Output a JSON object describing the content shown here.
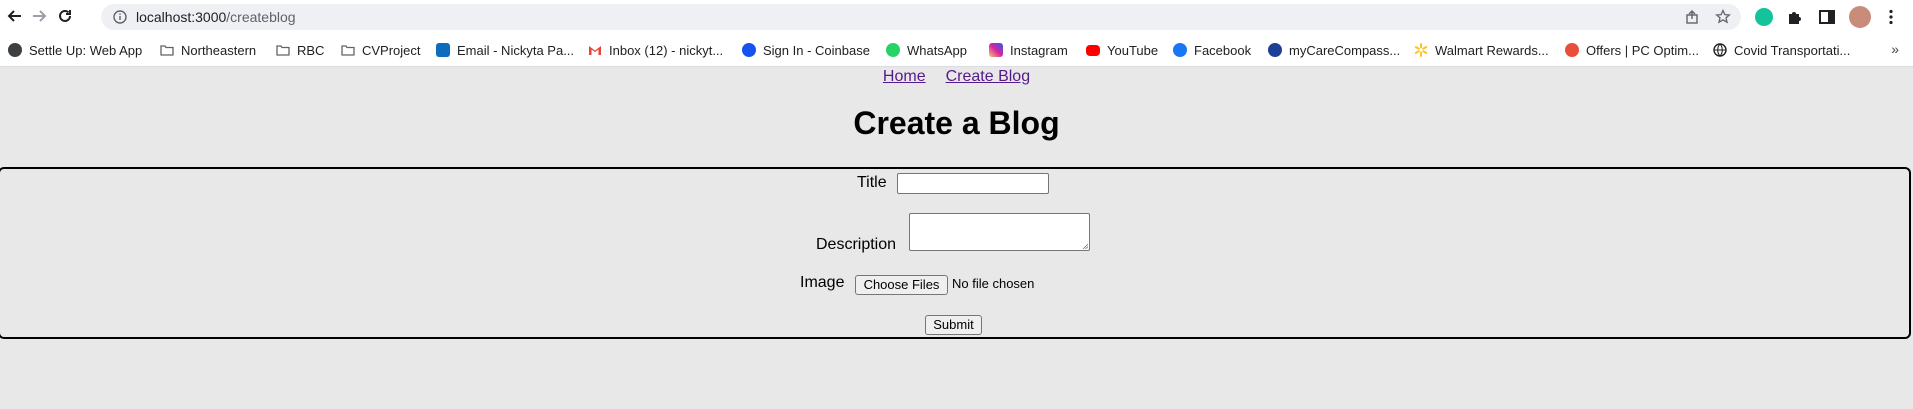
{
  "browser": {
    "url_host": "localhost:3000",
    "url_path": "/createblog",
    "bookmarks": [
      {
        "label": "Settle Up: Web App",
        "icon": "people-icon",
        "color": "#3c4043"
      },
      {
        "label": "Northeastern",
        "icon": "folder-icon",
        "color": "#5f6368"
      },
      {
        "label": "RBC",
        "icon": "folder-icon",
        "color": "#5f6368"
      },
      {
        "label": "CVProject",
        "icon": "folder-icon",
        "color": "#5f6368"
      },
      {
        "label": "Email - Nickyta Pa...",
        "icon": "outlook-icon",
        "color": "#0f6cbd"
      },
      {
        "label": "Inbox (12) - nickyt...",
        "icon": "gmail-icon",
        "color": "#ea4335"
      },
      {
        "label": "Sign In - Coinbase",
        "icon": "coinbase-icon",
        "color": "#1652f0"
      },
      {
        "label": "WhatsApp",
        "icon": "whatsapp-icon",
        "color": "#25d366"
      },
      {
        "label": "Instagram",
        "icon": "instagram-icon",
        "color": "#d6249f"
      },
      {
        "label": "YouTube",
        "icon": "youtube-icon",
        "color": "#ff0000"
      },
      {
        "label": "Facebook",
        "icon": "facebook-icon",
        "color": "#1877f2"
      },
      {
        "label": "myCareCompass...",
        "icon": "mycarecompass-icon",
        "color": "#1e3f96"
      },
      {
        "label": "Walmart Rewards...",
        "icon": "walmart-icon",
        "color": "#ffc220"
      },
      {
        "label": "Offers | PC Optim...",
        "icon": "pc-optimum-icon",
        "color": "#e94e3c"
      },
      {
        "label": "Covid Transportati...",
        "icon": "globe-icon",
        "color": "#202124"
      }
    ]
  },
  "nav": {
    "home": "Home",
    "create": "Create Blog"
  },
  "page": {
    "title": "Create a Blog"
  },
  "form": {
    "title_label": "Title",
    "title_value": "",
    "description_label": "Description",
    "description_value": "",
    "image_label": "Image",
    "choose_files": "Choose Files",
    "no_file": "No file chosen",
    "submit": "Submit"
  }
}
